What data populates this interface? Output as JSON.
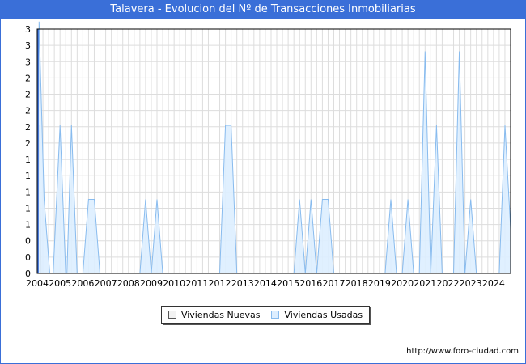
{
  "header": {
    "title": "Talavera - Evolucion del Nº de Transacciones Inmobiliarias"
  },
  "legend": {
    "nuevas_label": "Viviendas Nuevas",
    "usadas_label": "Viviendas Usadas"
  },
  "footer": {
    "url": "http://www.foro-ciudad.com"
  },
  "colors": {
    "title_bg": "#3a6fd8",
    "nuevas_fill": "#f2f2f2",
    "usadas_fill": "#ddeeff",
    "usadas_stroke": "#88bbee",
    "grid": "#dddddd"
  },
  "chart_data": {
    "type": "area",
    "title": "Talavera - Evolucion del Nº de Transacciones Inmobiliarias",
    "xlabel": "",
    "ylabel": "",
    "x_ticks": [
      "2004",
      "2005",
      "2006",
      "2007",
      "2008",
      "2009",
      "2010",
      "2011",
      "2012",
      "2013",
      "2014",
      "2015",
      "2016",
      "2017",
      "2018",
      "2019",
      "2020",
      "2021",
      "2022",
      "2023",
      "2024"
    ],
    "y_tick_labels": [
      "0",
      "0",
      "0",
      "1",
      "1",
      "1",
      "1",
      "1",
      "2",
      "2",
      "2",
      "2",
      "2",
      "3",
      "3",
      "3"
    ],
    "ylim": [
      0,
      3.3
    ],
    "xlim": [
      2004,
      2024.75
    ],
    "grid": true,
    "legend_position": "bottom-center",
    "series": [
      {
        "name": "Viviendas Nuevas",
        "points": [
          [
            2004.0,
            0
          ],
          [
            2004.08,
            2.0
          ],
          [
            2004.17,
            0
          ],
          [
            2024.75,
            0
          ]
        ]
      },
      {
        "name": "Viviendas Usadas",
        "points": [
          [
            2004.0,
            0
          ],
          [
            2004.08,
            3.4
          ],
          [
            2004.3,
            1.0
          ],
          [
            2004.55,
            0
          ],
          [
            2004.7,
            0
          ],
          [
            2005.0,
            2.0
          ],
          [
            2005.25,
            0
          ],
          [
            2005.3,
            0
          ],
          [
            2005.5,
            2.0
          ],
          [
            2005.75,
            0
          ],
          [
            2006.0,
            0
          ],
          [
            2006.25,
            1.0
          ],
          [
            2006.5,
            1.0
          ],
          [
            2006.75,
            0
          ],
          [
            2008.5,
            0
          ],
          [
            2008.75,
            1.0
          ],
          [
            2009.0,
            0
          ],
          [
            2009.0,
            0
          ],
          [
            2009.25,
            1.0
          ],
          [
            2009.5,
            0
          ],
          [
            2012.0,
            0
          ],
          [
            2012.25,
            2.0
          ],
          [
            2012.5,
            2.0
          ],
          [
            2012.75,
            0
          ],
          [
            2015.25,
            0
          ],
          [
            2015.5,
            1.0
          ],
          [
            2015.75,
            0
          ],
          [
            2015.75,
            0
          ],
          [
            2016.0,
            1.0
          ],
          [
            2016.25,
            0
          ],
          [
            2016.25,
            0
          ],
          [
            2016.5,
            1.0
          ],
          [
            2016.75,
            1.0
          ],
          [
            2017.0,
            0
          ],
          [
            2019.25,
            0
          ],
          [
            2019.5,
            1.0
          ],
          [
            2019.75,
            0
          ],
          [
            2020.0,
            0
          ],
          [
            2020.25,
            1.0
          ],
          [
            2020.5,
            0
          ],
          [
            2020.75,
            0
          ],
          [
            2021.0,
            3.0
          ],
          [
            2021.25,
            0
          ],
          [
            2021.25,
            0
          ],
          [
            2021.5,
            2.0
          ],
          [
            2021.75,
            0
          ],
          [
            2022.25,
            0
          ],
          [
            2022.5,
            3.0
          ],
          [
            2022.75,
            0
          ],
          [
            2022.75,
            0
          ],
          [
            2023.0,
            1.0
          ],
          [
            2023.25,
            0
          ],
          [
            2024.25,
            0
          ],
          [
            2024.5,
            2.0
          ],
          [
            2024.75,
            0.6
          ]
        ]
      }
    ]
  }
}
